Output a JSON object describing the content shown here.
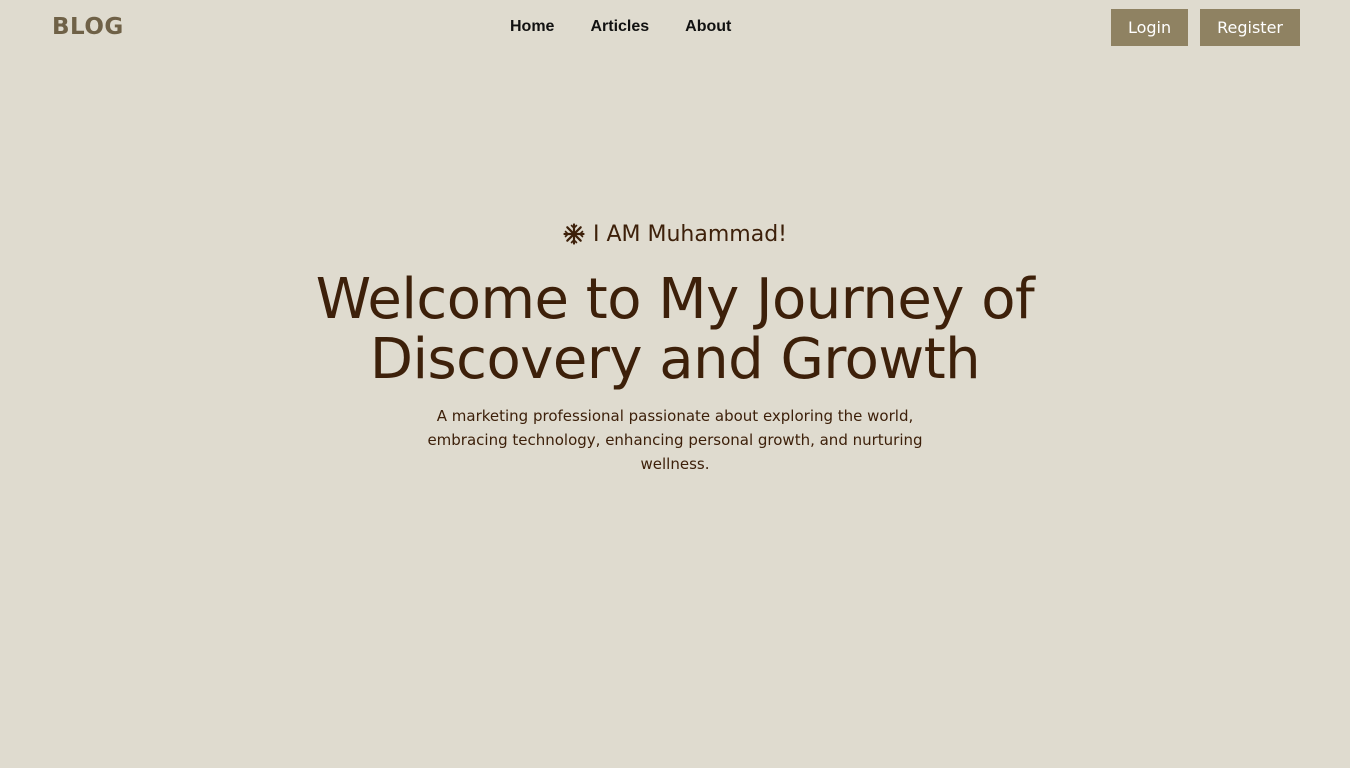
{
  "header": {
    "logo": "BLOG",
    "nav": [
      {
        "label": "Home"
      },
      {
        "label": "Articles"
      },
      {
        "label": "About"
      }
    ],
    "login_label": "Login",
    "register_label": "Register"
  },
  "hero": {
    "greeting": "I AM Muhammad!",
    "greeting_icon": "snowflake-icon",
    "headline_line1": "Welcome to My Journey of",
    "headline_line2": "Discovery and Growth",
    "subtitle": "A marketing professional passionate about exploring the world, embracing technology, enhancing personal growth, and nurturing wellness."
  },
  "colors": {
    "background": "#dfdbcf",
    "accent": "#8f8262",
    "logo": "#6f6147",
    "text": "#3d200a"
  }
}
